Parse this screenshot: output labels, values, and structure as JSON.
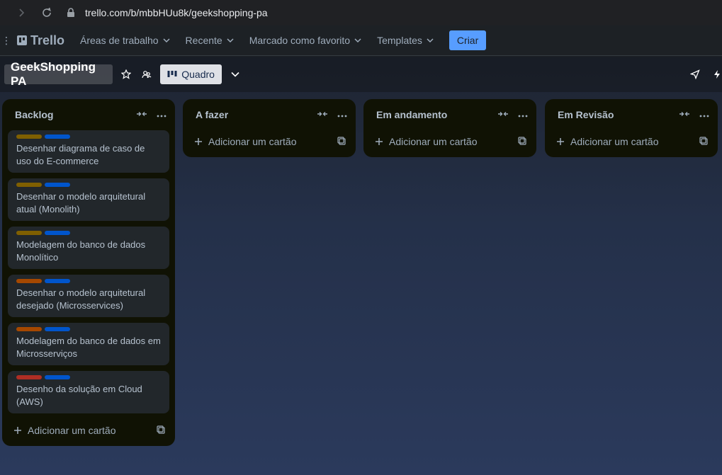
{
  "browser": {
    "url": "trello.com/b/mbbHUu8k/geekshopping-pa"
  },
  "header": {
    "logo": "Trello",
    "menu": [
      {
        "label": "Áreas de trabalho"
      },
      {
        "label": "Recente"
      },
      {
        "label": "Marcado como favorito"
      },
      {
        "label": "Templates"
      }
    ],
    "create_label": "Criar"
  },
  "board": {
    "title": "GeekShopping PA",
    "view_label": "Quadro"
  },
  "colors": {
    "label_yellow": "#7f5f01",
    "label_blue": "#0055cc",
    "label_orange": "#a54800",
    "label_red": "#ae2e24",
    "create_button": "#579dff"
  },
  "lists": [
    {
      "title": "Backlog",
      "add_label": "Adicionar um cartão",
      "cards": [
        {
          "title": "Desenhar diagrama de caso de uso do E-commerce",
          "labels": [
            "label_yellow",
            "label_blue"
          ]
        },
        {
          "title": "Desenhar o modelo arquitetural atual (Monolith)",
          "labels": [
            "label_yellow",
            "label_blue"
          ]
        },
        {
          "title": "Modelagem do banco de dados Monolítico",
          "labels": [
            "label_yellow",
            "label_blue"
          ]
        },
        {
          "title": "Desenhar o modelo arquitetural desejado (Microsservices)",
          "labels": [
            "label_orange",
            "label_blue"
          ]
        },
        {
          "title": "Modelagem do banco de dados em Microsserviços",
          "labels": [
            "label_orange",
            "label_blue"
          ]
        },
        {
          "title": "Desenho da solução em Cloud (AWS)",
          "labels": [
            "label_red",
            "label_blue"
          ]
        }
      ]
    },
    {
      "title": "A fazer",
      "add_label": "Adicionar um cartão",
      "cards": []
    },
    {
      "title": "Em andamento",
      "add_label": "Adicionar um cartão",
      "cards": []
    },
    {
      "title": "Em Revisão",
      "add_label": "Adicionar um cartão",
      "cards": []
    }
  ]
}
